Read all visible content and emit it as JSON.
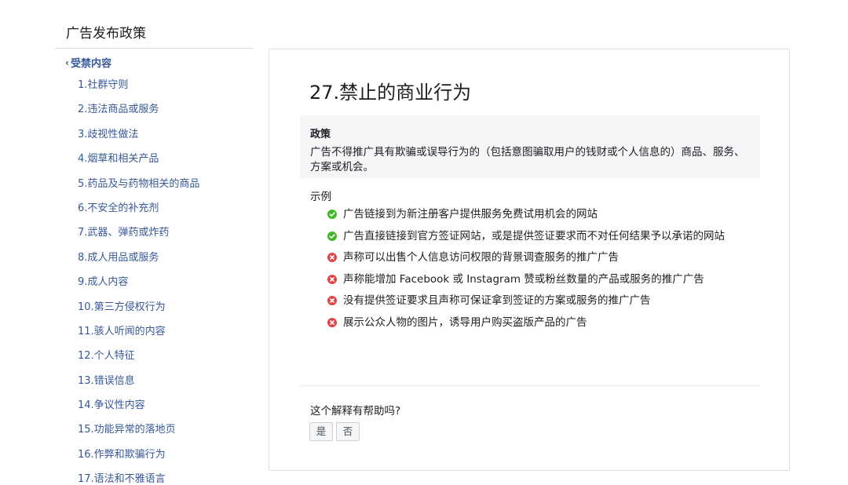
{
  "sidebar": {
    "title": "广告发布政策",
    "back_label": "受禁内容",
    "items": [
      "1.社群守则",
      "2.违法商品或服务",
      "3.歧视性做法",
      "4.烟草和相关产品",
      "5.药品及与药物相关的商品",
      "6.不安全的补充剂",
      "7.武器、弹药或炸药",
      "8.成人用品或服务",
      "9.成人内容",
      "10.第三方侵权行为",
      "11.骇人听闻的内容",
      "12.个人特征",
      "13.错误信息",
      "14.争议性内容",
      "15.功能异常的落地页",
      "16.作弊和欺骗行为",
      "17.语法和不雅语言"
    ]
  },
  "main": {
    "title": "27.禁止的商业行为",
    "policy_label": "政策",
    "policy_text": "广告不得推广具有欺骗或误导行为的（包括意图骗取用户的钱财或个人信息的）商品、服务、方案或机会。",
    "examples_label": "示例",
    "examples": [
      {
        "status": "allowed",
        "icon": "check-circle-icon",
        "text": "广告链接到为新注册客户提供服务免费试用机会的网站"
      },
      {
        "status": "allowed",
        "icon": "check-circle-icon",
        "text": "广告直接链接到官方签证网站，或是提供签证要求而不对任何结果予以承诺的网站"
      },
      {
        "status": "prohibited",
        "icon": "x-circle-icon",
        "text": "声称可以出售个人信息访问权限的背景调查服务的推广广告"
      },
      {
        "status": "prohibited",
        "icon": "x-circle-icon",
        "text": "声称能增加 Facebook 或 Instagram 赞或粉丝数量的产品或服务的推广广告"
      },
      {
        "status": "prohibited",
        "icon": "x-circle-icon",
        "text": "没有提供签证要求且声称可保证拿到签证的方案或服务的推广广告"
      },
      {
        "status": "prohibited",
        "icon": "x-circle-icon",
        "text": "展示公众人物的图片，诱导用户购买盗版产品的广告"
      }
    ],
    "helpful_question": "这个解释有帮助吗?",
    "yes_label": "是",
    "no_label": "否"
  },
  "colors": {
    "link": "#365899",
    "allowed": "#42b72a",
    "prohibited": "#e04545",
    "panel_bg": "#f5f6f7",
    "border": "#dddfe2"
  }
}
